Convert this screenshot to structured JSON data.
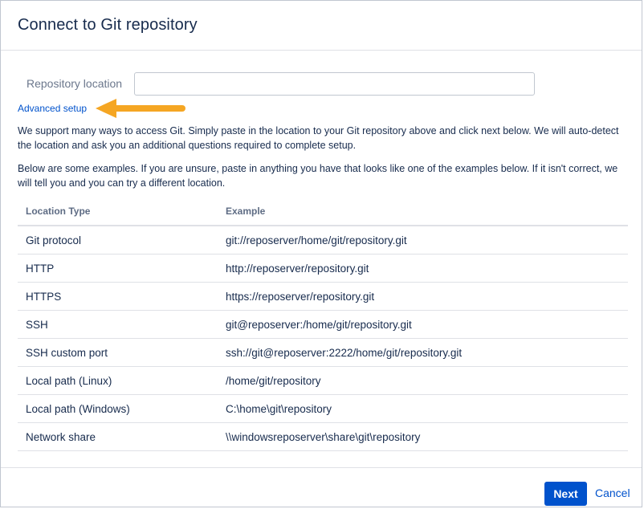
{
  "dialog": {
    "title": "Connect to Git repository"
  },
  "form": {
    "repo_label": "Repository location",
    "repo_value": "",
    "advanced_link": "Advanced setup"
  },
  "description": {
    "paragraph1": "We support many ways to access Git. Simply paste in the location to your Git repository above and click next below. We will auto-detect the location and ask you an additional questions required to complete setup.",
    "paragraph2": "Below are some examples. If you are unsure, paste in anything you have that looks like one of the examples below. If it isn't correct, we will tell you and you can try a different location."
  },
  "table": {
    "headers": [
      "Location Type",
      "Example"
    ],
    "rows": [
      [
        "Git protocol",
        "git://reposerver/home/git/repository.git"
      ],
      [
        "HTTP",
        "http://reposerver/repository.git"
      ],
      [
        "HTTPS",
        "https://reposerver/repository.git"
      ],
      [
        "SSH",
        "git@reposerver:/home/git/repository.git"
      ],
      [
        "SSH custom port",
        "ssh://git@reposerver:2222/home/git/repository.git"
      ],
      [
        "Local path (Linux)",
        "/home/git/repository"
      ],
      [
        "Local path (Windows)",
        "C:\\home\\git\\repository"
      ],
      [
        "Network share",
        "\\\\windowsreposerver\\share\\git\\repository"
      ]
    ]
  },
  "footer": {
    "next_label": "Next",
    "cancel_label": "Cancel"
  },
  "colors": {
    "primary": "#0052cc",
    "annotation_arrow": "#f5a623",
    "border": "#dfe1e6"
  },
  "icons": {
    "annotation": "left-arrow-icon"
  }
}
